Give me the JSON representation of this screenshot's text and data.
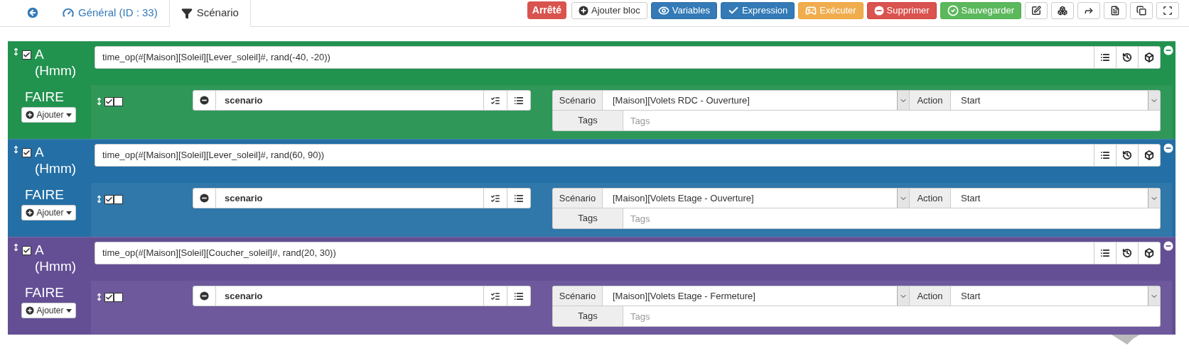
{
  "tabs": [
    {
      "kind": "back",
      "selected": false
    },
    {
      "kind": "general",
      "label": "Général (ID : 33)",
      "selected": false
    },
    {
      "kind": "scenario",
      "label": "Scénario",
      "selected": true
    }
  ],
  "status_badge": "Arrêté",
  "toolbar_buttons": [
    {
      "label": "Ajouter bloc",
      "kind": "default"
    },
    {
      "label": "Variables",
      "kind": "primary"
    },
    {
      "label": "Expression",
      "kind": "primary"
    },
    {
      "label": "Exécuter",
      "kind": "warning"
    },
    {
      "label": "Supprimer",
      "kind": "danger"
    },
    {
      "label": "Sauvegarder",
      "kind": "success"
    }
  ],
  "blocks": [
    {
      "color": "#22924f",
      "condition": {
        "checked": true,
        "label": "A (Hmm)",
        "expression": "time_op(#[Maison][Soleil][Lever_soleil]#, rand(-40, -20))"
      },
      "do_label": "FAIRE",
      "add_button": "Ajouter",
      "actions": [
        {
          "enabled": true,
          "parallel": false,
          "command": "scenario",
          "scenario_label": "Scénario",
          "scenario": "[Maison][Volets RDC - Ouverture]",
          "action_label": "Action",
          "action": "Start",
          "tags_label": "Tags",
          "tags_placeholder": "Tags"
        }
      ]
    },
    {
      "color": "#246fa5",
      "condition": {
        "checked": true,
        "label": "A (Hmm)",
        "expression": "time_op(#[Maison][Soleil][Lever_soleil]#, rand(60, 90))"
      },
      "do_label": "FAIRE",
      "add_button": "Ajouter",
      "actions": [
        {
          "enabled": true,
          "parallel": false,
          "command": "scenario",
          "scenario_label": "Scénario",
          "scenario": "[Maison][Volets Etage - Ouverture]",
          "action_label": "Action",
          "action": "Start",
          "tags_label": "Tags",
          "tags_placeholder": "Tags"
        }
      ]
    },
    {
      "color": "#644f95",
      "condition": {
        "checked": true,
        "label": "A (Hmm)",
        "expression": "time_op(#[Maison][Soleil][Coucher_soleil]#, rand(20, 30))"
      },
      "do_label": "FAIRE",
      "add_button": "Ajouter",
      "actions": [
        {
          "enabled": true,
          "parallel": false,
          "command": "scenario",
          "scenario_label": "Scénario",
          "scenario": "[Maison][Volets Etage - Fermeture]",
          "action_label": "Action",
          "action": "Start",
          "tags_label": "Tags",
          "tags_placeholder": "Tags"
        }
      ]
    }
  ]
}
